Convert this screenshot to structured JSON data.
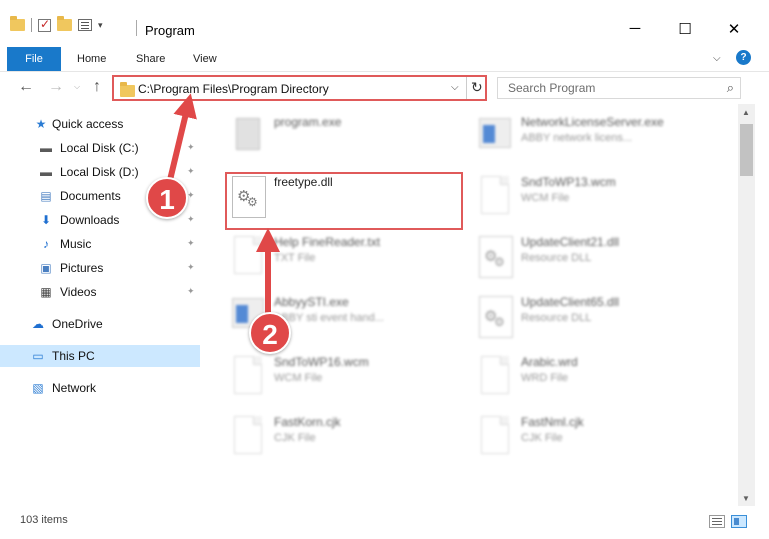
{
  "window": {
    "title": "Program",
    "minimize": "─",
    "maximize": "☐",
    "close": "✕"
  },
  "ribbon": {
    "tabs": [
      "File",
      "Home",
      "Share",
      "View"
    ],
    "collapse": "⌵",
    "help": "?"
  },
  "navigation": {
    "back": "←",
    "forward": "→",
    "recent": "⌵",
    "up": "↑",
    "address": "C:\\Program Files\\Program Directory",
    "address_drop": "⌵",
    "refresh": "↻",
    "search_placeholder": "Search Program",
    "search_icon": "⌕"
  },
  "sidebar": {
    "items": [
      {
        "label": "Quick access",
        "icon": "star-icon",
        "glyph": "★",
        "color": "#2b7cd3",
        "pinned": false
      },
      {
        "label": "Local Disk (C:)",
        "icon": "drive-icon",
        "glyph": "▬",
        "color": "#5a5a5a",
        "pinned": true
      },
      {
        "label": "Local Disk (D:)",
        "icon": "drive-icon",
        "glyph": "▬",
        "color": "#5a5a5a",
        "pinned": true
      },
      {
        "label": "Documents",
        "icon": "documents-icon",
        "glyph": "▤",
        "color": "#4a7fc1",
        "pinned": true
      },
      {
        "label": "Downloads",
        "icon": "download-icon",
        "glyph": "⬇",
        "color": "#1f6fd0",
        "pinned": true
      },
      {
        "label": "Music",
        "icon": "music-icon",
        "glyph": "♪",
        "color": "#1f6fd0",
        "pinned": true
      },
      {
        "label": "Pictures",
        "icon": "pictures-icon",
        "glyph": "▣",
        "color": "#4a7fc1",
        "pinned": true
      },
      {
        "label": "Videos",
        "icon": "videos-icon",
        "glyph": "▦",
        "color": "#444444",
        "pinned": true
      },
      {
        "label": "OneDrive",
        "icon": "cloud-icon",
        "glyph": "☁",
        "color": "#1f6fd0",
        "pinned": false
      },
      {
        "label": "This PC",
        "icon": "computer-icon",
        "glyph": "▭",
        "color": "#2b7cd3",
        "pinned": false
      },
      {
        "label": "Network",
        "icon": "network-icon",
        "glyph": "▧",
        "color": "#2b7cd3",
        "pinned": false
      }
    ],
    "pin_glyph": "📌"
  },
  "files": [
    {
      "name": "program.exe",
      "type": "",
      "icon": "program-icon"
    },
    {
      "name": "NetworkLicenseServer.exe",
      "type": "ABBY network licens...",
      "icon": "exe-icon"
    },
    {
      "name": "freetype.dll",
      "type": "",
      "icon": "dll-icon"
    },
    {
      "name": "SndToWP13.wcm",
      "type": "WCM File",
      "icon": "document-icon"
    },
    {
      "name": "Help FineReader.txt",
      "type": "TXT File",
      "icon": "document-icon"
    },
    {
      "name": "UpdateClient21.dll",
      "type": "Resource DLL",
      "icon": "dll-icon"
    },
    {
      "name": "AbbyySTI.exe",
      "type": "ABBY sti event hand...",
      "icon": "exe-icon"
    },
    {
      "name": "UpdateClient65.dll",
      "type": "Resource DLL",
      "icon": "dll-icon"
    },
    {
      "name": "SndToWP16.wcm",
      "type": "WCM File",
      "icon": "document-icon"
    },
    {
      "name": "Arabic.wrd",
      "type": "WRD File",
      "icon": "document-icon"
    },
    {
      "name": "FastKorn.cjk",
      "type": "CJK File",
      "icon": "document-icon"
    },
    {
      "name": "FastNml.cjk",
      "type": "CJK File",
      "icon": "document-icon"
    }
  ],
  "status": {
    "item_count": "103 items"
  },
  "callouts": [
    "1",
    "2"
  ],
  "colors": {
    "accent": "#1979ca",
    "highlight": "#e05a5a",
    "callout": "#e04848",
    "selection": "#cce8ff"
  }
}
